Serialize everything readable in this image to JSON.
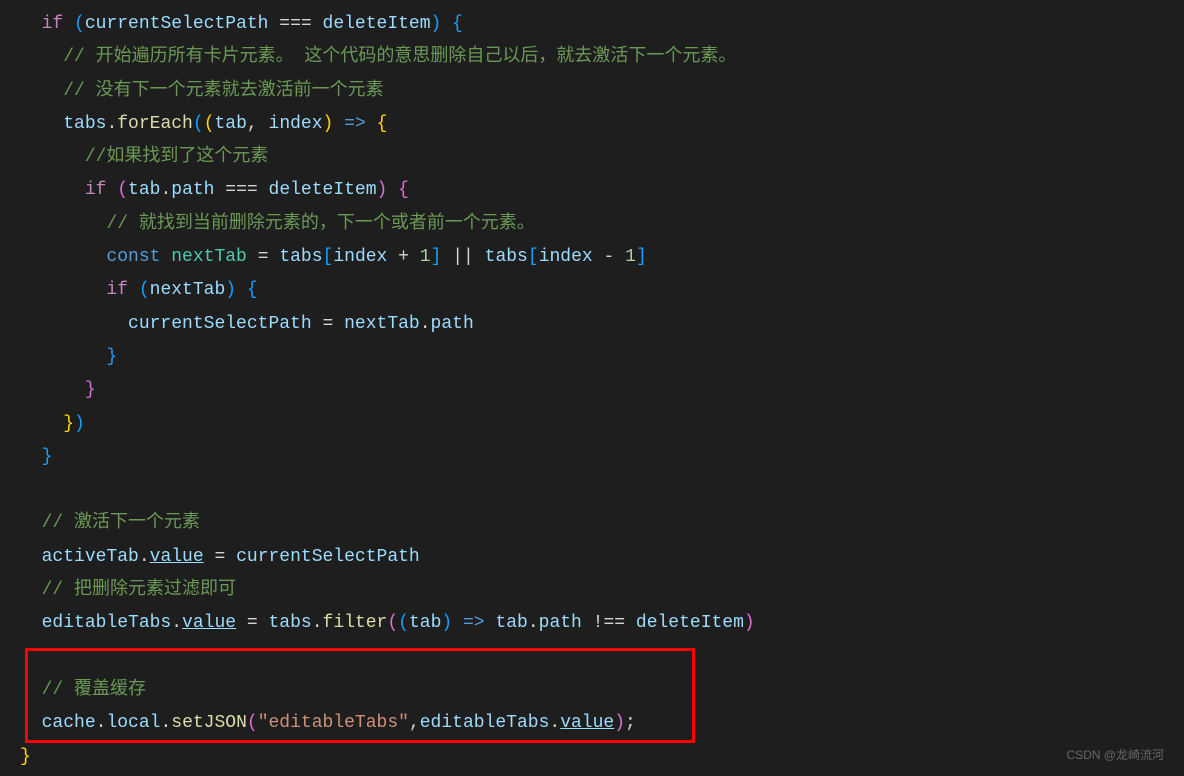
{
  "lines": {
    "l1": {
      "indent": "  ",
      "kw_if": "if",
      "var1": "currentSelectPath",
      "op_eq": "===",
      "var2": "deleteItem"
    },
    "l2": {
      "indent": "    ",
      "comment": "// 开始遍历所有卡片元素。 这个代码的意思删除自己以后，就去激活下一个元素。"
    },
    "l3": {
      "indent": "    ",
      "comment": "// 没有下一个元素就去激活前一个元素"
    },
    "l4": {
      "indent": "    ",
      "var": "tabs",
      "fn": "forEach",
      "param1": "tab",
      "param2": "index",
      "arrow": "=>"
    },
    "l5": {
      "indent": "      ",
      "comment": "//如果找到了这个元素"
    },
    "l6": {
      "indent": "      ",
      "kw_if": "if",
      "var1": "tab",
      "prop": "path",
      "op_eq": "===",
      "var2": "deleteItem"
    },
    "l7": {
      "indent": "        ",
      "comment": "// 就找到当前删除元素的，下一个或者前一个元素。"
    },
    "l8": {
      "indent": "        ",
      "kw_const": "const",
      "var": "nextTab",
      "tabs": "tabs",
      "idx": "index",
      "n1": "1",
      "op_or": "||",
      "n2": "1"
    },
    "l9": {
      "indent": "        ",
      "kw_if": "if",
      "var": "nextTab"
    },
    "l10": {
      "indent": "          ",
      "var1": "currentSelectPath",
      "var2": "nextTab",
      "prop": "path"
    },
    "l11": {
      "indent": "        "
    },
    "l12": {
      "indent": "      "
    },
    "l13": {
      "indent": "    "
    },
    "l14": {
      "indent": "  "
    },
    "l15": {
      "indent": "  "
    },
    "l16": {
      "indent": "  ",
      "comment": "// 激活下一个元素"
    },
    "l17": {
      "indent": "  ",
      "var1": "activeTab",
      "prop1": "value",
      "var2": "currentSelectPath"
    },
    "l18": {
      "indent": "  ",
      "comment": "// 把删除元素过滤即可"
    },
    "l19": {
      "indent": "  ",
      "var1": "editableTabs",
      "prop1": "value",
      "tabs": "tabs",
      "fn": "filter",
      "param": "tab",
      "arrow": "=>",
      "tabvar": "tab",
      "prop2": "path",
      "op_ne": "!==",
      "var3": "deleteItem"
    },
    "l20": {
      "indent": "  "
    },
    "l21": {
      "indent": "  ",
      "comment": "// 覆盖缓存"
    },
    "l22": {
      "indent": "  ",
      "var1": "cache",
      "prop1": "local",
      "fn": "setJSON",
      "str": "\"editableTabs\"",
      "var2": "editableTabs",
      "prop2": "value"
    }
  },
  "watermark": "CSDN @龙崎流河"
}
